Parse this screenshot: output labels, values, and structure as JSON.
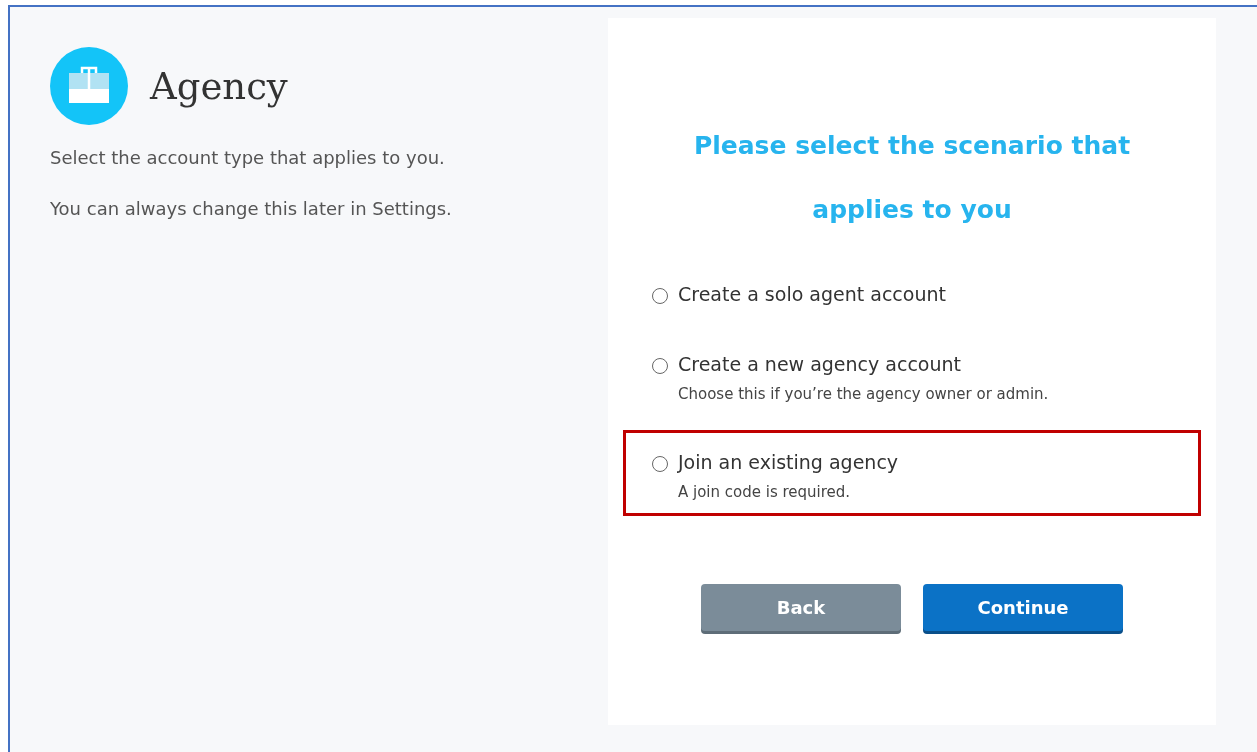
{
  "header": {
    "title": "Agency"
  },
  "intro": [
    "Select the account type that applies to you.",
    "You can always change this later in Settings."
  ],
  "panel": {
    "heading": "Please select the scenario that applies to you",
    "options": [
      {
        "label": "Create a solo agent account",
        "selected": false,
        "highlighted": false
      },
      {
        "label": "Create a new agency account",
        "note": "Choose this if you’re the agency owner or admin.",
        "selected": false,
        "highlighted": false
      },
      {
        "label": "Join an existing agency",
        "note": "A join code is required.",
        "selected": false,
        "highlighted": true
      }
    ],
    "buttons": [
      {
        "label": "Back",
        "kind": "secondary"
      },
      {
        "label": "Continue",
        "kind": "primary"
      }
    ]
  }
}
